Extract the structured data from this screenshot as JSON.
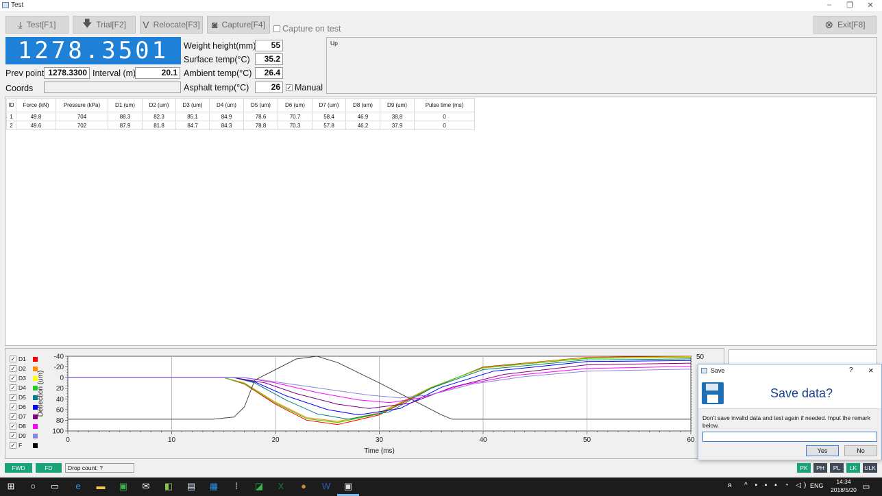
{
  "window": {
    "title": "Test"
  },
  "toolbar": {
    "test": "Test[F1]",
    "trial": "Trial[F2]",
    "relocate": "Relocate[F3]",
    "capture": "Capture[F4]",
    "capture_on_test": "Capture on test",
    "exit": "Exit[F8]"
  },
  "readout": "1278.3501",
  "info": {
    "prev_point_label": "Prev point",
    "prev_point_value": "1278.3300",
    "interval_label": "Interval (m)",
    "interval_value": "20.1",
    "coords_label": "Coords",
    "coords_value": "",
    "weight_label": "Weight height(mm)",
    "weight_value": "55",
    "surface_label": "Surface temp(°C)",
    "surface_value": "35.2",
    "ambient_label": "Ambient temp(°C)",
    "ambient_value": "26.4",
    "asphalt_label": "Asphalt temp(°C)",
    "asphalt_value": "26",
    "manual_label": "Manual"
  },
  "up_panel_label": "Up",
  "table": {
    "headers": [
      "ID",
      "Force (kN)",
      "Pressure (kPa)",
      "D1 (um)",
      "D2 (um)",
      "D3 (um)",
      "D4 (um)",
      "D5 (um)",
      "D6 (um)",
      "D7 (um)",
      "D8 (um)",
      "D9 (um)",
      "Pulse time (ms)"
    ],
    "rows": [
      [
        "1",
        "49.8",
        "704",
        "88.3",
        "82.3",
        "85.1",
        "84.9",
        "78.6",
        "70.7",
        "58.4",
        "46.9",
        "38.8",
        "0"
      ],
      [
        "2",
        "49.6",
        "702",
        "87.9",
        "81.8",
        "84.7",
        "84.3",
        "78.8",
        "70.3",
        "57.8",
        "46.2",
        "37.9",
        "0"
      ]
    ]
  },
  "legend": [
    {
      "label": "D1",
      "color": "#ff0000"
    },
    {
      "label": "D2",
      "color": "#ff8c00"
    },
    {
      "label": "D3",
      "color": "#ffff00"
    },
    {
      "label": "D4",
      "color": "#22cc22"
    },
    {
      "label": "D5",
      "color": "#008080"
    },
    {
      "label": "D6",
      "color": "#0000ff"
    },
    {
      "label": "D7",
      "color": "#800080"
    },
    {
      "label": "D8",
      "color": "#ff00ff"
    },
    {
      "label": "D9",
      "color": "#8888dd"
    },
    {
      "label": "F",
      "color": "#000000"
    }
  ],
  "chart_data": {
    "type": "line",
    "xlabel": "Time (ms)",
    "ylabel": "Deflection (um)",
    "xlim": [
      0,
      60
    ],
    "ylim_left": [
      -40,
      100
    ],
    "y_inverted": true,
    "x_ticks": [
      "0",
      "10",
      "20",
      "30",
      "40",
      "50",
      "60"
    ],
    "y_ticks": [
      "-40",
      "-20",
      "0",
      "20",
      "40",
      "60",
      "80",
      "100"
    ],
    "right_axis_tick": "50",
    "series": [
      {
        "name": "D1",
        "color": "#ff0000",
        "points": [
          [
            0,
            0
          ],
          [
            15,
            0
          ],
          [
            17,
            12
          ],
          [
            20,
            50
          ],
          [
            23,
            80
          ],
          [
            26,
            88
          ],
          [
            30,
            70
          ],
          [
            35,
            20
          ],
          [
            40,
            -20
          ],
          [
            50,
            -38
          ],
          [
            60,
            -40
          ]
        ]
      },
      {
        "name": "D2",
        "color": "#ff8c00",
        "points": [
          [
            0,
            0
          ],
          [
            15,
            0
          ],
          [
            17,
            10
          ],
          [
            20,
            46
          ],
          [
            23,
            75
          ],
          [
            26,
            82
          ],
          [
            30,
            66
          ],
          [
            35,
            18
          ],
          [
            40,
            -18
          ],
          [
            50,
            -36
          ],
          [
            60,
            -38
          ]
        ]
      },
      {
        "name": "D3",
        "color": "#ffff00",
        "points": [
          [
            0,
            0
          ],
          [
            15,
            0
          ],
          [
            17,
            11
          ],
          [
            20,
            48
          ],
          [
            23,
            77
          ],
          [
            26,
            85
          ],
          [
            30,
            68
          ],
          [
            35,
            19
          ],
          [
            40,
            -19
          ],
          [
            50,
            -37
          ],
          [
            60,
            -39
          ]
        ]
      },
      {
        "name": "D4",
        "color": "#22cc22",
        "points": [
          [
            0,
            0
          ],
          [
            15,
            0
          ],
          [
            17,
            11
          ],
          [
            20,
            48
          ],
          [
            23,
            77
          ],
          [
            26,
            84
          ],
          [
            30,
            68
          ],
          [
            35,
            19
          ],
          [
            40,
            -19
          ],
          [
            50,
            -36
          ],
          [
            60,
            -38
          ]
        ]
      },
      {
        "name": "D5",
        "color": "#008080",
        "points": [
          [
            0,
            0
          ],
          [
            16,
            0
          ],
          [
            18,
            10
          ],
          [
            21,
            42
          ],
          [
            24,
            68
          ],
          [
            27,
            78
          ],
          [
            31,
            64
          ],
          [
            35,
            20
          ],
          [
            40,
            -15
          ],
          [
            50,
            -33
          ],
          [
            60,
            -35
          ]
        ]
      },
      {
        "name": "D6",
        "color": "#0000ff",
        "points": [
          [
            0,
            0
          ],
          [
            16,
            0
          ],
          [
            18,
            8
          ],
          [
            21,
            34
          ],
          [
            25,
            60
          ],
          [
            28,
            70
          ],
          [
            32,
            58
          ],
          [
            36,
            18
          ],
          [
            41,
            -12
          ],
          [
            50,
            -30
          ],
          [
            60,
            -32
          ]
        ]
      },
      {
        "name": "D7",
        "color": "#800080",
        "points": [
          [
            0,
            0
          ],
          [
            16,
            0
          ],
          [
            19,
            10
          ],
          [
            22,
            30
          ],
          [
            26,
            50
          ],
          [
            29,
            58
          ],
          [
            33,
            48
          ],
          [
            37,
            18
          ],
          [
            42,
            -6
          ],
          [
            50,
            -24
          ],
          [
            60,
            -27
          ]
        ]
      },
      {
        "name": "D8",
        "color": "#ff00ff",
        "points": [
          [
            0,
            0
          ],
          [
            17,
            0
          ],
          [
            20,
            10
          ],
          [
            24,
            28
          ],
          [
            28,
            42
          ],
          [
            31,
            47
          ],
          [
            34,
            38
          ],
          [
            38,
            14
          ],
          [
            43,
            -4
          ],
          [
            50,
            -17
          ],
          [
            60,
            -21
          ]
        ]
      },
      {
        "name": "D9",
        "color": "#8888dd",
        "points": [
          [
            0,
            0
          ],
          [
            17,
            0
          ],
          [
            20,
            8
          ],
          [
            25,
            22
          ],
          [
            29,
            33
          ],
          [
            32,
            38
          ],
          [
            35,
            32
          ],
          [
            39,
            12
          ],
          [
            44,
            -2
          ],
          [
            50,
            -12
          ],
          [
            60,
            -16
          ]
        ]
      },
      {
        "name": "F",
        "color": "#444444",
        "points": [
          [
            0,
            78
          ],
          [
            14,
            78
          ],
          [
            16,
            74
          ],
          [
            17,
            55
          ],
          [
            18,
            5
          ],
          [
            20,
            -15
          ],
          [
            22,
            -35
          ],
          [
            24,
            -40
          ],
          [
            26,
            -28
          ],
          [
            30,
            10
          ],
          [
            33,
            40
          ],
          [
            36,
            70
          ],
          [
            37,
            78
          ],
          [
            60,
            78
          ]
        ]
      }
    ]
  },
  "dialog": {
    "title": "Save",
    "help": "?",
    "close": "×",
    "heading": "Save data?",
    "message": "Don't save invalid data and test again if needed. Input the remark below.",
    "input_value": "",
    "yes": "Yes",
    "no": "No"
  },
  "status": {
    "fwd": "FWD",
    "fd": "FD",
    "drop_count": "Drop count: ?",
    "pk": "PK",
    "ph": "PH",
    "pl": "PL",
    "lk": "LK",
    "ulk": "ULK"
  },
  "taskbar": {
    "lang": "ENG",
    "time": "14:34",
    "date": "2018/5/20"
  }
}
